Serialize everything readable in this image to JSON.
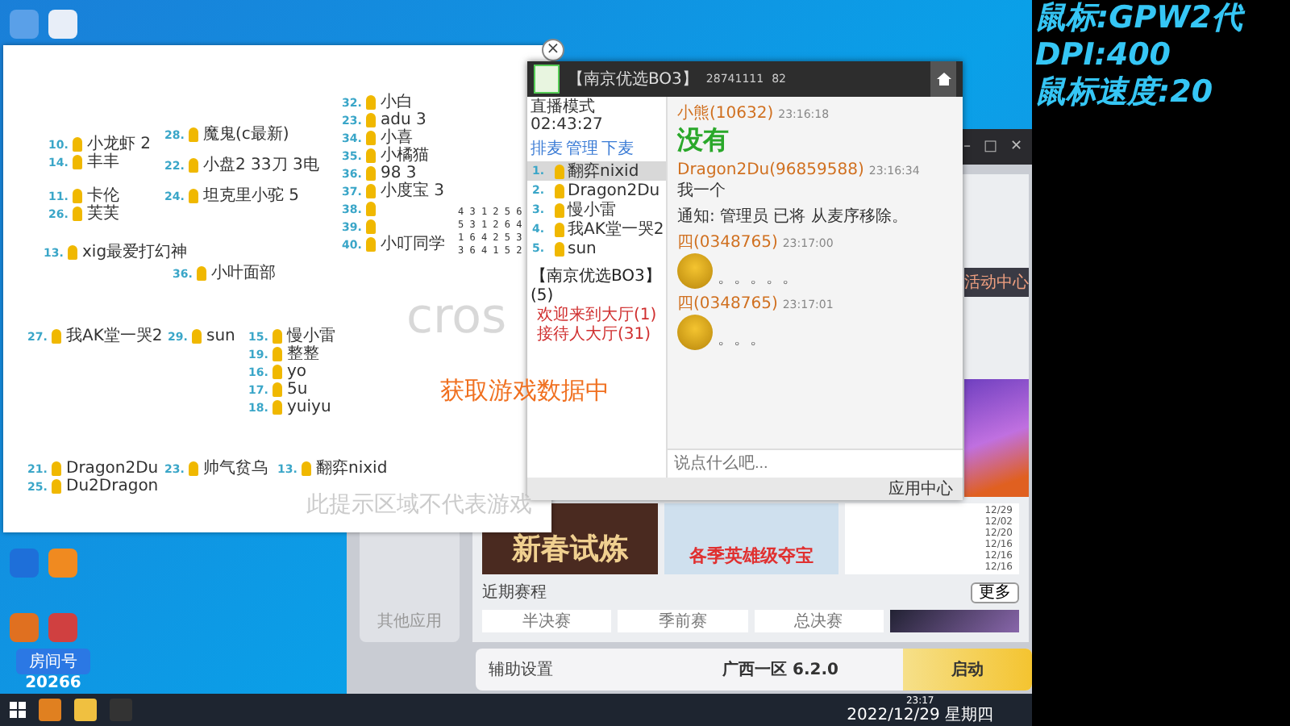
{
  "stream_overlay": {
    "lines": [
      "鼠标:GPW2代",
      "DPI:400",
      "鼠标速度:20"
    ],
    "room_label": "房间号",
    "room_number": "20266",
    "watermark": "cros",
    "loading_text": "获取游戏数据中",
    "notice": "此提示区域不代表游戏"
  },
  "board": {
    "groups": [
      {
        "entries": [
          {
            "number": "10.",
            "name": "小龙虾 2"
          },
          {
            "number": "14.",
            "name": "丰丰"
          }
        ]
      },
      {
        "entries": [
          {
            "number": "11.",
            "name": "卡伦"
          },
          {
            "number": "26.",
            "name": "芙芙"
          }
        ]
      },
      {
        "entries": [
          {
            "number": "13.",
            "name": "xig最爱打幻神"
          }
        ]
      },
      {
        "entries": [
          {
            "number": "28.",
            "name": "魔鬼(c最新)"
          }
        ]
      },
      {
        "entries": [
          {
            "number": "22.",
            "name": "小盘2 33刀 3电"
          }
        ]
      },
      {
        "entries": [
          {
            "number": "24.",
            "name": "坦克里小驼 5"
          }
        ]
      },
      {
        "entries": [
          {
            "number": "36.",
            "name": "小叶面部"
          }
        ]
      },
      {
        "entries": [
          {
            "number": "32.",
            "name": "小白"
          },
          {
            "number": "23.",
            "name": "adu 3"
          },
          {
            "number": "34.",
            "name": "小喜"
          },
          {
            "number": "35.",
            "name": "小橘猫"
          },
          {
            "number": "36.",
            "name": "98 3"
          },
          {
            "number": "37.",
            "name": "小度宝 3"
          },
          {
            "number": "38."
          },
          {
            "number": "39."
          },
          {
            "number": "40.",
            "name": "小叮同学"
          }
        ]
      },
      {
        "entries": [
          {
            "number": "27.",
            "name": "我AK堂一哭2"
          }
        ]
      },
      {
        "entries": [
          {
            "number": "29.",
            "name": "sun"
          }
        ]
      },
      {
        "entries": [
          {
            "number": "15.",
            "name": "慢小雷"
          },
          {
            "number": "19.",
            "name": "整整"
          },
          {
            "number": "16.",
            "name": "yo"
          },
          {
            "number": "17.",
            "name": "5u"
          },
          {
            "number": "18.",
            "name": "yuiyu"
          }
        ]
      },
      {
        "entries": [
          {
            "number": "21.",
            "name": "Dragon2Du"
          },
          {
            "number": "25.",
            "name": "Du2Dragon"
          }
        ]
      },
      {
        "entries": [
          {
            "number": "23.",
            "name": "帅气贫乌"
          }
        ]
      },
      {
        "entries": [
          {
            "number": "13.",
            "name": "翻弈nixid"
          }
        ]
      }
    ],
    "grid_rows": [
      "4 3 1 2 5 6",
      "5 3 1 2 6 4",
      "1 6 4 2 5 3",
      "3 6 4 1 5 2"
    ],
    "close": "×"
  },
  "chat": {
    "title": "【南京优选BO3】",
    "room_id": "28741111",
    "online": "82",
    "mode": "直播模式 02:43:27",
    "mode_actions": [
      "排麦",
      "管理",
      "下麦"
    ],
    "mic_queue": [
      {
        "number": "1.",
        "name": "翻弈nixid",
        "selected": true
      },
      {
        "number": "2.",
        "name": "Dragon2Du",
        "selected": false
      },
      {
        "number": "3.",
        "name": "慢小雷",
        "selected": false
      },
      {
        "number": "4.",
        "name": "我AK堂一哭2",
        "selected": false
      },
      {
        "number": "5.",
        "name": "sun",
        "selected": false
      }
    ],
    "channels": [
      {
        "name": "【南京优选BO3】(5)",
        "children": [
          {
            "name": "欢迎来到大厅(1)"
          },
          {
            "name": "接待人大厅(31)"
          }
        ]
      }
    ],
    "messages": [
      {
        "kind": "text",
        "sender": "小熊(10632)",
        "time": "23:16:18",
        "text": "没有",
        "big": true
      },
      {
        "kind": "text",
        "sender": "Dragon2Du(96859588)",
        "time": "23:16:34",
        "text": "我一个",
        "big": false
      },
      {
        "kind": "notice",
        "text": "通知: 管理员 已将 从麦序移除。"
      },
      {
        "kind": "sticker",
        "sender": "四(0348765)",
        "time": "23:17:00",
        "text": "。。。。。"
      },
      {
        "kind": "sticker",
        "sender": "四(0348765)",
        "time": "23:17:01",
        "text": "。。。"
      }
    ],
    "input_placeholder": "说点什么吧...",
    "app_center": "应用中心"
  },
  "launcher": {
    "window_controls": [
      "–",
      "□",
      "✕"
    ],
    "activity": "活动中心",
    "banners": [
      "新春试炼",
      "各季英雄级夺宝"
    ],
    "news_dates": [
      "12/29",
      "12/02",
      "12/20",
      "12/16",
      "12/16",
      "12/16"
    ],
    "schedule_title": "近期赛程",
    "more": "更多",
    "matches": [
      "半决赛",
      "季前赛",
      "总决赛"
    ],
    "assist": "辅助设置",
    "server": "广西一区 6.2.0",
    "start": "启动",
    "other_apps": "其他应用"
  },
  "taskbar": {
    "time": "23:17",
    "date": "2022/12/29 星期四"
  }
}
